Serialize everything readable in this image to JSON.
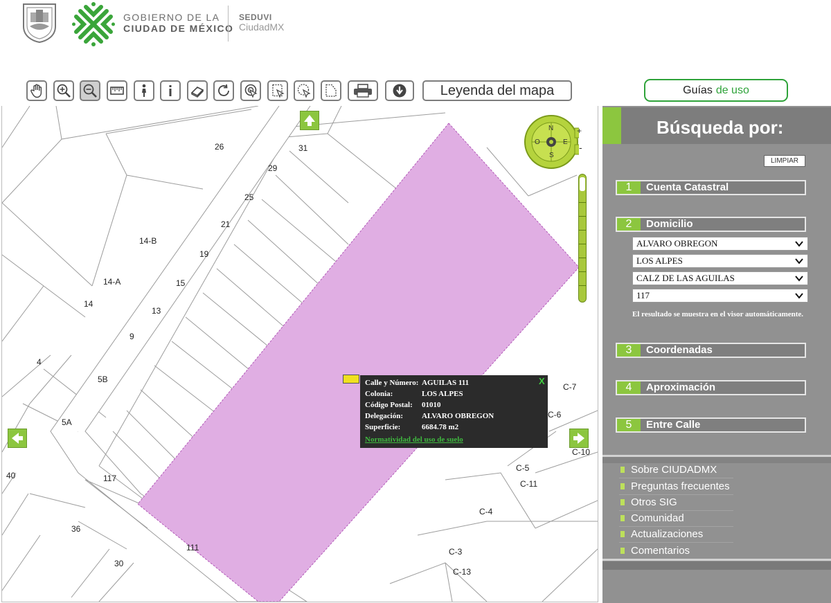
{
  "header": {
    "gov_line1": "GOBIERNO DE LA",
    "gov_line2": "CIUDAD DE MÉXICO",
    "agency": "SEDUVI",
    "brand": "CiudadMX"
  },
  "toolbar": {
    "tools": [
      "pan-icon",
      "zoom-in-icon",
      "zoom-out-icon",
      "measure-icon",
      "street-view-icon",
      "info-icon",
      "eraser-icon",
      "refresh-icon",
      "identify-icon",
      "select-rectangle-icon",
      "select-circle-icon",
      "select-polygon-icon",
      "print-icon",
      "download-icon"
    ],
    "legend_label": "Leyenda del mapa"
  },
  "guides": {
    "label_a": "Guías",
    "label_b": "de uso"
  },
  "map": {
    "plot_numbers": [
      "26",
      "31",
      "29",
      "25",
      "21",
      "14-B",
      "19",
      "14-A",
      "15",
      "14",
      "13",
      "9",
      "4",
      "5B",
      "5A",
      "40",
      "117",
      "36",
      "30",
      "111",
      "C-7",
      "C-6",
      "C-10",
      "C-5",
      "C-11",
      "C-4",
      "C-3",
      "C-13"
    ],
    "compass": {
      "n": "N",
      "s": "S",
      "e": "E",
      "o": "O",
      "plus": "+",
      "minus": "-"
    },
    "colors": {
      "highlight": "#e0aee3",
      "highlight_border": "#b25ab8",
      "nav_green": "#8cc63f"
    }
  },
  "popup": {
    "rows": [
      {
        "label": "Calle y Número:",
        "value": "AGUILAS 111"
      },
      {
        "label": "Colonia:",
        "value": "LOS ALPES"
      },
      {
        "label": "Código Postal:",
        "value": "01010"
      },
      {
        "label": "Delegación:",
        "value": "ALVARO OBREGON"
      },
      {
        "label": "Superficie:",
        "value": "6684.78 m2"
      }
    ],
    "link": "Normatividad del uso de suelo",
    "close": "X"
  },
  "panel": {
    "title": "Búsqueda por:",
    "clear": "LIMPIAR",
    "sections": [
      {
        "num": "1",
        "label": "Cuenta Catastral"
      },
      {
        "num": "2",
        "label": "Domicilio"
      },
      {
        "num": "3",
        "label": "Coordenadas"
      },
      {
        "num": "4",
        "label": "Aproximación"
      },
      {
        "num": "5",
        "label": "Entre Calle"
      }
    ],
    "domicilio": {
      "delegacion": "ALVARO OBREGON",
      "colonia": "LOS ALPES",
      "calle": "CALZ DE LAS AGUILAS",
      "numero": "117"
    },
    "note": "El resultado se muestra en el visor automáticamente.",
    "links": [
      "Sobre CIUDADMX",
      "Preguntas frecuentes",
      "Otros SIG",
      "Comunidad",
      "Actualizaciones",
      "Comentarios"
    ]
  }
}
